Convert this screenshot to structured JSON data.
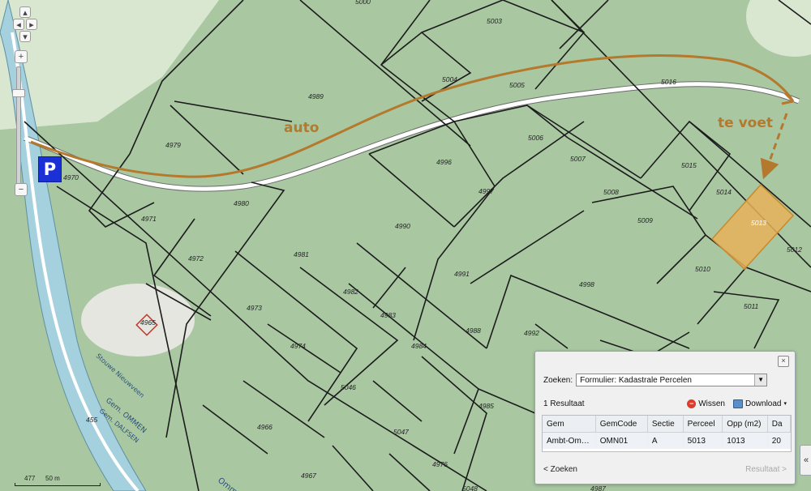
{
  "map": {
    "parcels": [
      {
        "id": "p5003",
        "num": "5003"
      },
      {
        "id": "p5004",
        "num": "5004"
      },
      {
        "id": "p5005",
        "num": "5005"
      },
      {
        "id": "p5016",
        "num": "5016"
      },
      {
        "id": "p4989",
        "num": "4989"
      },
      {
        "id": "p4979",
        "num": "4979"
      },
      {
        "id": "p4970",
        "num": "4970"
      },
      {
        "id": "p4996",
        "num": "4996"
      },
      {
        "id": "p5006",
        "num": "5006"
      },
      {
        "id": "p5007",
        "num": "5007"
      },
      {
        "id": "p5015",
        "num": "5015"
      },
      {
        "id": "p5014",
        "num": "5014"
      },
      {
        "id": "p5008",
        "num": "5008"
      },
      {
        "id": "p4997",
        "num": "4997"
      },
      {
        "id": "p4980",
        "num": "4980"
      },
      {
        "id": "p4971",
        "num": "4971"
      },
      {
        "id": "p5009",
        "num": "5009"
      },
      {
        "id": "p5013",
        "num": "5013"
      },
      {
        "id": "p4990",
        "num": "4990"
      },
      {
        "id": "p5012",
        "num": "5012"
      },
      {
        "id": "p4972",
        "num": "4972"
      },
      {
        "id": "p4981",
        "num": "4981"
      },
      {
        "id": "p5010",
        "num": "5010"
      },
      {
        "id": "p4991",
        "num": "4991"
      },
      {
        "id": "p4998",
        "num": "4998"
      },
      {
        "id": "p4982",
        "num": "4982"
      },
      {
        "id": "p4973",
        "num": "4973"
      },
      {
        "id": "p5011",
        "num": "5011"
      },
      {
        "id": "p4983",
        "num": "4983"
      },
      {
        "id": "p4965",
        "num": "4965"
      },
      {
        "id": "p4988",
        "num": "4988"
      },
      {
        "id": "p4992",
        "num": "4992"
      },
      {
        "id": "p4974",
        "num": "4974"
      },
      {
        "id": "p4984",
        "num": "4984"
      },
      {
        "id": "p5046",
        "num": "5046"
      },
      {
        "id": "p4985",
        "num": "4985"
      },
      {
        "id": "p4966",
        "num": "4966"
      },
      {
        "id": "p5047",
        "num": "5047"
      },
      {
        "id": "p4976",
        "num": "4976"
      },
      {
        "id": "p4967",
        "num": "4967"
      },
      {
        "id": "p5048",
        "num": "5048"
      },
      {
        "id": "p4987",
        "num": "4987"
      },
      {
        "id": "p455",
        "num": "455"
      },
      {
        "id": "p5000",
        "num": "5000"
      }
    ],
    "annotations": {
      "auto": "auto",
      "te_voet": "te voet"
    },
    "road_labels": {
      "street": "Stouwe Nieuwveen",
      "gem": "Gem. OMMEN",
      "gem2": "Gem. DALFSEN",
      "omm": "Omm"
    },
    "parking": "P",
    "scale": {
      "left": "477",
      "label": "50 m"
    },
    "colors": {
      "forest": "#a9c8a2",
      "highlight": "#e8b25a",
      "route": "#b5792d",
      "water": "#a5d0dd",
      "road": "#ffffff"
    }
  },
  "zoom": {
    "plus": "+",
    "minus": "−"
  },
  "panel": {
    "search_label": "Zoeken:",
    "search_value": "Formulier: Kadastrale Percelen",
    "result_count": "1 Resultaat",
    "clear_label": "Wissen",
    "download_label": "Download",
    "columns": [
      "Gem",
      "GemCode",
      "Sectie",
      "Perceel",
      "Opp (m2)",
      "Da"
    ],
    "rows": [
      [
        "Ambt-Om…",
        "OMN01",
        "A",
        "5013",
        "1013",
        "20"
      ]
    ],
    "prev_label": "< Zoeken",
    "next_label": "Resultaat >",
    "close": "×",
    "collapse": "«"
  }
}
